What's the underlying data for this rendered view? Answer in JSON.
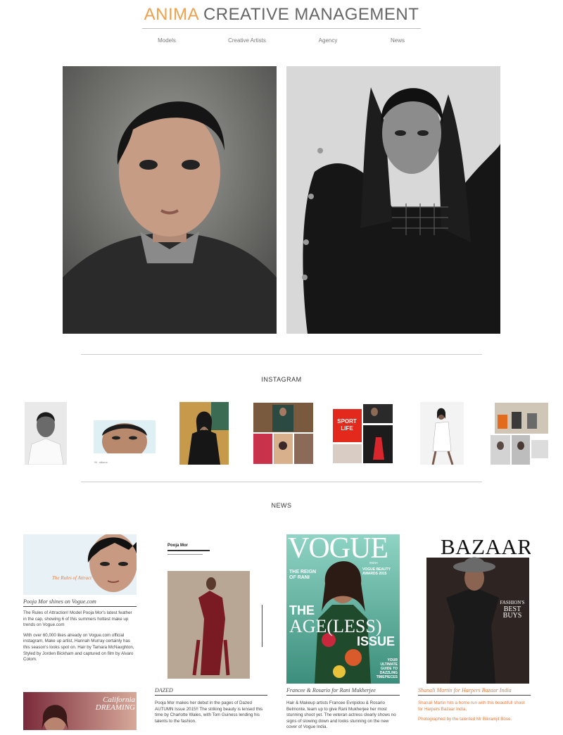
{
  "brand": {
    "name_accent": "ANIMA",
    "name_rest": "CREATIVE MANAGEMENT"
  },
  "nav": {
    "items": [
      {
        "label": "Models"
      },
      {
        "label": "Creative Artists"
      },
      {
        "label": "Agency"
      },
      {
        "label": "News"
      }
    ]
  },
  "sections": {
    "instagram": "INSTAGRAM",
    "news": "NEWS"
  },
  "instagram": {
    "tile2_caption": "99 · alliance"
  },
  "news": [
    {
      "title": "Pooja Mor shines on Vogue.com",
      "image_caption": "The Rules of Attract",
      "body": [
        "The Rules of Attraction! Model Pooja Mor's latest feather in the cap, showing 6 of this summers hottest make up trends on Vogue.com",
        "With over 60,000 likes already on Vogue.com official instagram, Make up artist, Hannah Murray certainly has this season's looks spot on. Hair by Tamara McNaughton, Styled by Jorden Bickham and captured on film by Alvaro Colom."
      ]
    },
    {
      "title": "DAZED",
      "image_caption": "Pooja Mor",
      "body": [
        "Pooja Mor makes her debut in the pages of Dazed AUTUMN Issue 2015!! The striking beauty is lensed this time by Charlotte Wales, with Tom Guiness lending his talents to the fashion."
      ]
    },
    {
      "title": "Francee & Rosario for Rani Mukherjee",
      "image_caption": "VOGUE",
      "cover": {
        "edition": "INDIA",
        "beauty_awards": "VOGUE BEAUTY AWARDS 2015",
        "headline_1": "THE",
        "headline_2": "AGE(LESS)",
        "headline_3": "ISSUE",
        "reign": "THE REIGN OF RANI",
        "guide": "YOUR ULTIMATE GUIDE TO DAZZLING TIMEPIECES"
      },
      "body": [
        "Hair & Makeup artists Francee Evripidou & Rosario Belmonte, team up to give Rani Mukherjee her most stunning shoot yet. The veteran actress clearly shows no signs of slowing down and looks stunning on the new cover of Vogue India."
      ]
    },
    {
      "title": "Shanali Martin for Harpers Bazaar India",
      "image_caption": "BAZAAR",
      "cover": {
        "side_1": "FASHION'S",
        "side_2": "BEST",
        "side_3": "BUYS"
      },
      "body": [
        "Shanali Martin hits a home run with this beautifull shoot for Harpers Bazaar India.",
        "Photographed by the talented Mr Bikramjit Bose."
      ]
    },
    {
      "title": "",
      "image_caption": "California DREAMING",
      "body": []
    }
  ]
}
